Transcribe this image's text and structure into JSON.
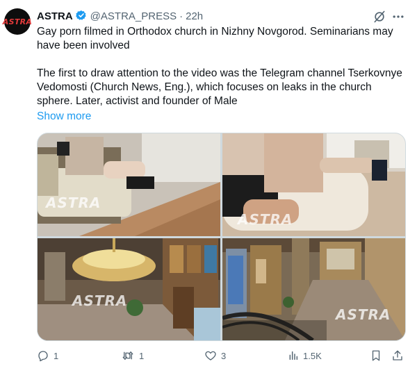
{
  "account": {
    "avatar_text": "ASTRA",
    "name": "ASTRA",
    "handle": "@ASTRA_PRESS",
    "separator": "·",
    "time": "22h"
  },
  "tweet": {
    "paragraph1": "Gay porn filmed in Orthodox church in Nizhny Novgorod. Seminarians may have been involved",
    "paragraph2": "The first to draw attention to the video was the Telegram channel Tserkovnye Vedomosti (Church News, Eng.), which focuses on leaks in the church sphere. Later, activist and founder of Male",
    "show_more": "Show more"
  },
  "media": {
    "watermark": "ASTRA",
    "images": [
      "blurred-person-on-couch",
      "blurred-person-on-couch-closeup",
      "church-chandelier-interior",
      "church-interior-railing"
    ]
  },
  "actions": {
    "replies": "1",
    "reposts": "1",
    "likes": "3",
    "views": "1.5K"
  },
  "colors": {
    "accent": "#1d9bf0",
    "secondary_text": "#536471",
    "avatar_text": "#e03a3a"
  },
  "icons": [
    "verified-badge-icon",
    "grok-icon",
    "more-icon",
    "reply-icon",
    "repost-icon",
    "like-icon",
    "views-icon",
    "bookmark-icon",
    "share-icon"
  ]
}
